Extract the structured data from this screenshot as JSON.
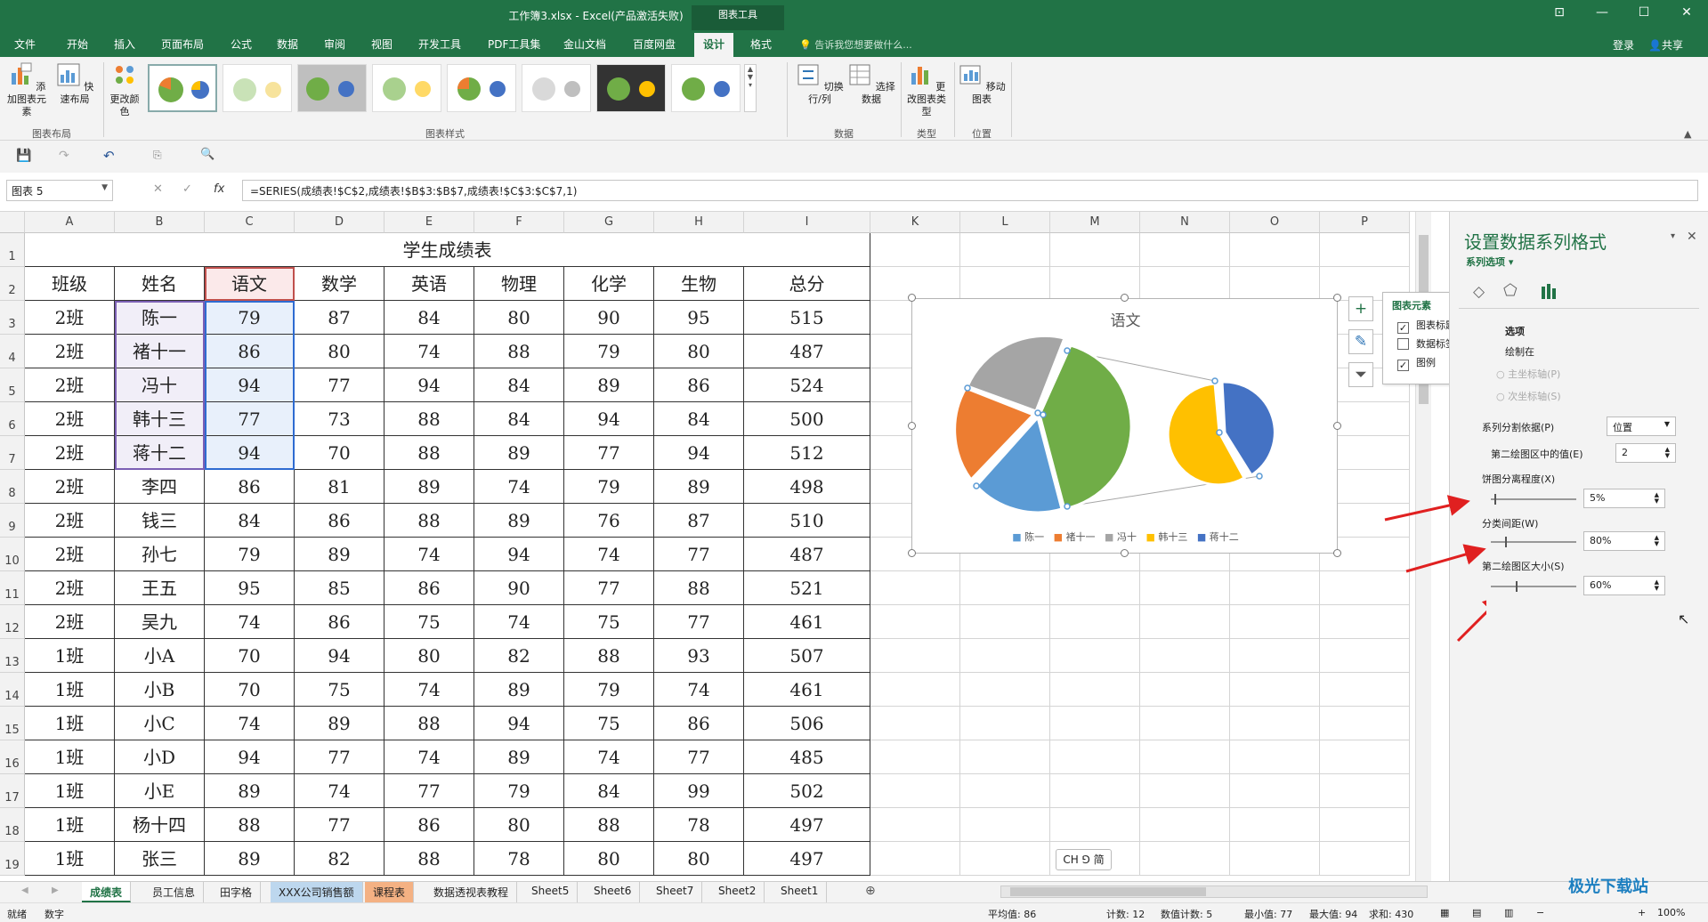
{
  "window": {
    "title": "工作簿3.xlsx - Excel(产品激活失败)",
    "context_tab": "图表工具",
    "controls": [
      "⊡",
      "—",
      "☐",
      "✕"
    ]
  },
  "tabs": [
    "文件",
    "开始",
    "插入",
    "页面布局",
    "公式",
    "数据",
    "审阅",
    "视图",
    "开发工具",
    "PDF工具集",
    "金山文档",
    "百度网盘",
    "设计",
    "格式"
  ],
  "active_tab": "设计",
  "tell_me": "告诉我您想要做什么...",
  "login": "登录",
  "share": "共享",
  "ribbon": {
    "add_element": "添加图表元素",
    "quick_layout": "快速布局",
    "change_colors": "更改颜色",
    "group_layout": "图表布局",
    "group_styles": "图表样式",
    "switch_row_col": "切换行/列",
    "select_data": "选择数据",
    "group_data": "数据",
    "change_type": "更改图表类型",
    "group_type": "类型",
    "move_chart": "移动图表",
    "group_location": "位置"
  },
  "name_box": "图表 5",
  "formula": "=SERIES(成绩表!$C$2,成绩表!$B$3:$B$7,成绩表!$C$3:$C$7,1)",
  "columns": [
    "A",
    "B",
    "C",
    "D",
    "E",
    "F",
    "G",
    "H",
    "I",
    "K",
    "L",
    "M",
    "N",
    "O",
    "P"
  ],
  "row_numbers": [
    "1",
    "2",
    "3",
    "4",
    "5",
    "6",
    "7",
    "8",
    "9",
    "10",
    "11",
    "12",
    "13",
    "14",
    "15",
    "16",
    "17",
    "18",
    "19"
  ],
  "sheet_title": "学生成绩表",
  "headers": [
    "班级",
    "姓名",
    "语文",
    "数学",
    "英语",
    "物理",
    "化学",
    "生物",
    "总分"
  ],
  "rows": [
    [
      "2班",
      "陈一",
      "79",
      "87",
      "84",
      "80",
      "90",
      "95",
      "515"
    ],
    [
      "2班",
      "褚十一",
      "86",
      "80",
      "74",
      "88",
      "79",
      "80",
      "487"
    ],
    [
      "2班",
      "冯十",
      "94",
      "77",
      "94",
      "84",
      "89",
      "86",
      "524"
    ],
    [
      "2班",
      "韩十三",
      "77",
      "73",
      "88",
      "84",
      "94",
      "84",
      "500"
    ],
    [
      "2班",
      "蒋十二",
      "94",
      "70",
      "88",
      "89",
      "77",
      "94",
      "512"
    ],
    [
      "2班",
      "李四",
      "86",
      "81",
      "89",
      "74",
      "79",
      "89",
      "498"
    ],
    [
      "2班",
      "钱三",
      "84",
      "86",
      "88",
      "89",
      "76",
      "87",
      "510"
    ],
    [
      "2班",
      "孙七",
      "79",
      "89",
      "74",
      "94",
      "74",
      "77",
      "487"
    ],
    [
      "2班",
      "王五",
      "95",
      "85",
      "86",
      "90",
      "77",
      "88",
      "521"
    ],
    [
      "2班",
      "吴九",
      "74",
      "86",
      "75",
      "74",
      "75",
      "77",
      "461"
    ],
    [
      "1班",
      "小A",
      "70",
      "94",
      "80",
      "82",
      "88",
      "93",
      "507"
    ],
    [
      "1班",
      "小B",
      "70",
      "75",
      "74",
      "89",
      "79",
      "74",
      "461"
    ],
    [
      "1班",
      "小C",
      "74",
      "89",
      "88",
      "94",
      "75",
      "86",
      "506"
    ],
    [
      "1班",
      "小D",
      "94",
      "77",
      "74",
      "89",
      "74",
      "77",
      "485"
    ],
    [
      "1班",
      "小E",
      "89",
      "74",
      "77",
      "79",
      "84",
      "99",
      "502"
    ],
    [
      "1班",
      "杨十四",
      "88",
      "77",
      "86",
      "80",
      "88",
      "78",
      "497"
    ],
    [
      "1班",
      "张三",
      "89",
      "82",
      "88",
      "78",
      "80",
      "80",
      "497"
    ]
  ],
  "chart": {
    "title": "语文",
    "legend": [
      "陈一",
      "褚十一",
      "冯十",
      "韩十三",
      "蒋十二"
    ],
    "colors": [
      "#5b9bd5",
      "#ed7d31",
      "#a5a5a5",
      "#ffc000",
      "#4472c4",
      "#70ad47"
    ]
  },
  "chart_elements": {
    "title": "图表元素",
    "items": [
      {
        "label": "图表标题",
        "checked": true
      },
      {
        "label": "数据标签",
        "checked": false
      },
      {
        "label": "图例",
        "checked": true
      }
    ]
  },
  "pane": {
    "title": "设置数据系列格式",
    "series_options": "系列选项",
    "section": "选项",
    "plot_on": "绘制在",
    "primary_axis": "主坐标轴(P)",
    "secondary_axis": "次坐标轴(S)",
    "split_by_label": "系列分割依据(P)",
    "split_by_value": "位置",
    "second_plot_values_label": "第二绘图区中的值(E)",
    "second_plot_values": "2",
    "explosion_label": "饼图分离程度(X)",
    "explosion": "5%",
    "gap_width_label": "分类间距(W)",
    "gap_width": "80%",
    "second_plot_size_label": "第二绘图区大小(S)",
    "second_plot_size": "60%"
  },
  "ime": "CH ⅁ 简",
  "sheets": [
    "成绩表",
    "员工信息",
    "田字格",
    "XXX公司销售额",
    "课程表",
    "数据透视表教程",
    "Sheet5",
    "Sheet6",
    "Sheet7",
    "Sheet2",
    "Sheet1"
  ],
  "status": {
    "ready": "就绪",
    "numeric": "数字",
    "average": "平均值: 86",
    "count": "计数: 12",
    "numeric_count": "数值计数: 5",
    "min": "最小值: 77",
    "max": "最大值: 94",
    "sum": "求和: 430",
    "zoom": "100%"
  },
  "watermark": "极光下载站"
}
